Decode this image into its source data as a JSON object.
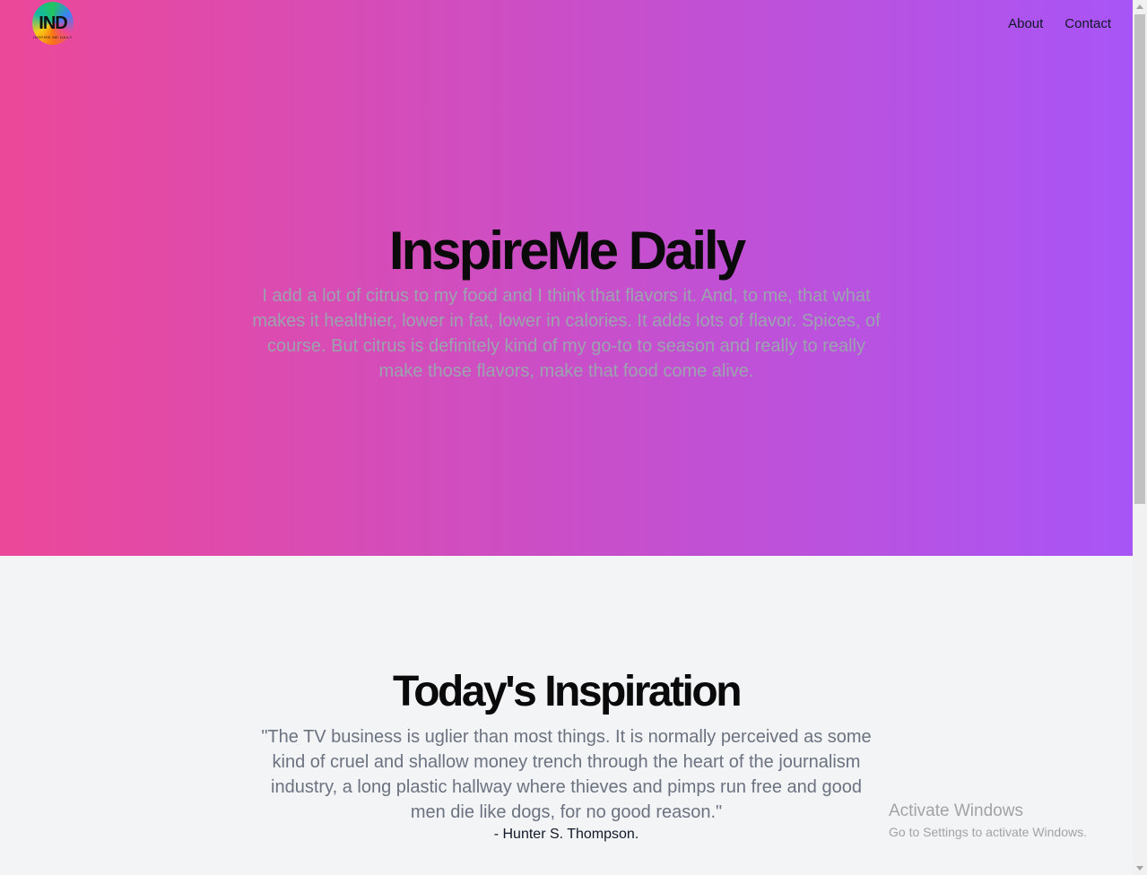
{
  "navbar": {
    "logo_text": "IND",
    "logo_subtext": "INSPIRE ME DAILY",
    "links": [
      {
        "label": "About"
      },
      {
        "label": "Contact"
      }
    ]
  },
  "hero": {
    "title": "InspireMe Daily",
    "text": "I add a lot of citrus to my food and I think that flavors it. And, to me, that what makes it healthier, lower in fat, lower in calories. It adds lots of flavor. Spices, of course. But citrus is definitely kind of my go-to to season and really to really make those flavors, make that food come alive.",
    "gradient_start": "#ec4899",
    "gradient_end": "#a855f7"
  },
  "inspiration": {
    "title": "Today's Inspiration",
    "quote": "\"The TV business is uglier than most things. It is normally perceived as some kind of cruel and shallow money trench through the heart of the journalism industry, a long plastic hallway where thieves and pimps run free and good men die like dogs, for no good reason.\"",
    "author": "- Hunter S. Thompson."
  },
  "watermark": {
    "title": "Activate Windows",
    "subtitle": "Go to Settings to activate Windows."
  }
}
